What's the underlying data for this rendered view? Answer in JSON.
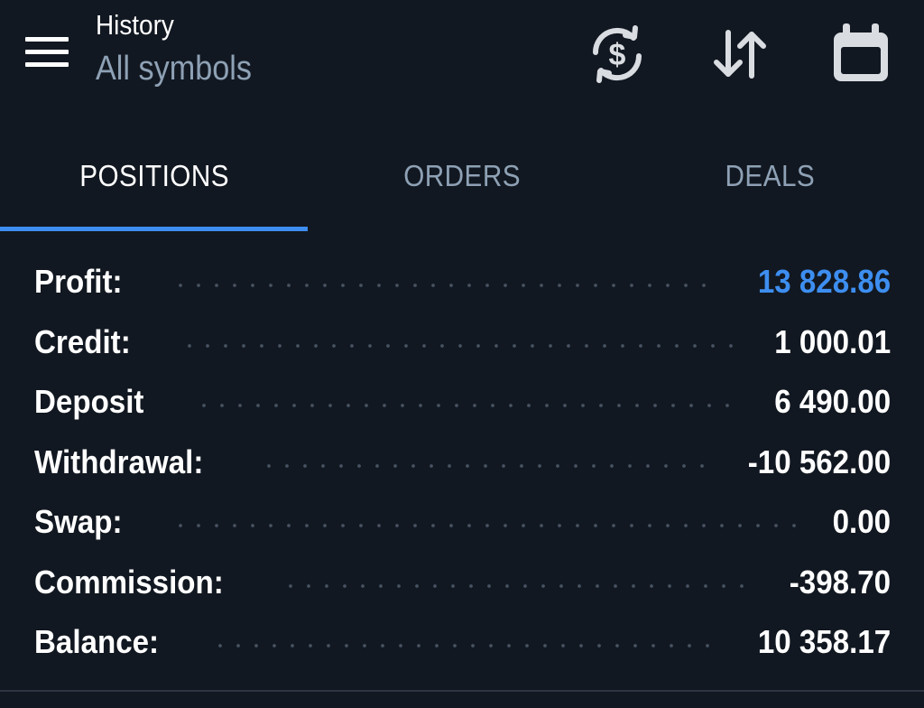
{
  "header": {
    "title": "History",
    "subtitle": "All symbols",
    "icons": [
      "menu-icon",
      "currency-exchange-icon",
      "sort-icon",
      "calendar-icon"
    ]
  },
  "tabs": [
    {
      "label": "POSITIONS",
      "active": true
    },
    {
      "label": "ORDERS",
      "active": false
    },
    {
      "label": "DEALS",
      "active": false
    }
  ],
  "summary": [
    {
      "label": "Profit:",
      "value": "13 828.86"
    },
    {
      "label": "Credit:",
      "value": "1 000.01"
    },
    {
      "label": "Deposit",
      "value": "6 490.00"
    },
    {
      "label": "Withdrawal:",
      "value": "-10 562.00"
    },
    {
      "label": "Swap:",
      "value": "0.00"
    },
    {
      "label": "Commission:",
      "value": "-398.70"
    },
    {
      "label": "Balance:",
      "value": "10 358.17"
    }
  ],
  "colors": {
    "background": "#121821",
    "accent": "#3d8ef0",
    "muted_text": "#8ea1b5",
    "icon": "#d9dde2",
    "dots": "#465161"
  }
}
